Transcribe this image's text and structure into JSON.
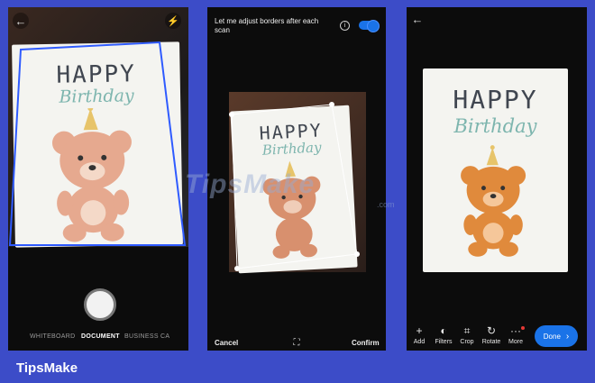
{
  "card": {
    "line1": "HAPPY",
    "line2": "Birthday"
  },
  "capture": {
    "modes": [
      "WHITEBOARD",
      "DOCUMENT",
      "BUSINESS CA"
    ],
    "active_mode": "DOCUMENT"
  },
  "adjust": {
    "setting_label": "Let me adjust borders after each scan",
    "toggle_on": true,
    "cancel_label": "Cancel",
    "confirm_label": "Confirm"
  },
  "review": {
    "toolbar": [
      {
        "label": "Add",
        "icon": "plus-icon"
      },
      {
        "label": "Filters",
        "icon": "filters-icon"
      },
      {
        "label": "Crop",
        "icon": "crop-icon"
      },
      {
        "label": "Rotate",
        "icon": "rotate-icon"
      },
      {
        "label": "More",
        "icon": "more-icon"
      }
    ],
    "done_label": "Done"
  },
  "watermark": {
    "text": "TipsMake",
    "suffix": ".com"
  },
  "brand": "TipsMake",
  "colors": {
    "accent": "#1a73e8",
    "frame": "#3c4cc8",
    "crop_line": "#2f5bff"
  }
}
